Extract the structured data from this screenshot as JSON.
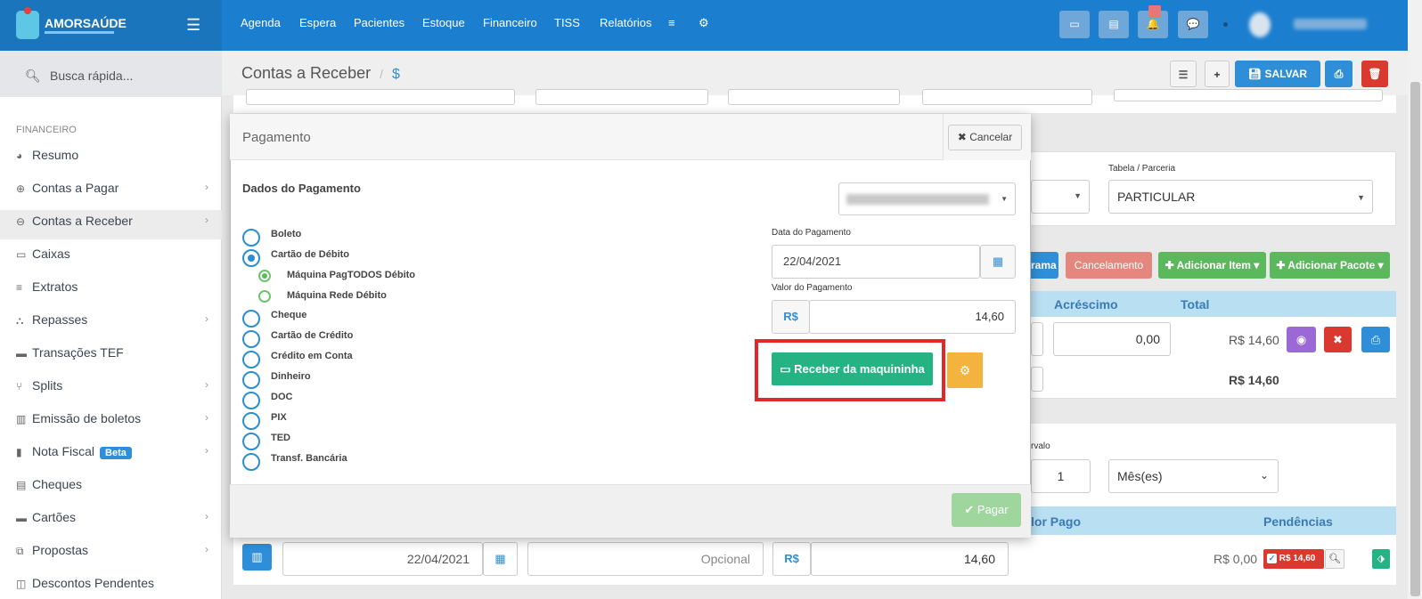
{
  "brand": {
    "name": "AMORSAÚDE"
  },
  "topnav": [
    "Agenda",
    "Espera",
    "Pacientes",
    "Estoque",
    "Financeiro",
    "TISS",
    "Relatórios"
  ],
  "sidebar": {
    "search_placeholder": "Busca rápida...",
    "section": "FINANCEIRO",
    "items": [
      {
        "label": "Resumo",
        "icon": "pie-icon"
      },
      {
        "label": "Contas a Pagar",
        "icon": "arrow-up-icon"
      },
      {
        "label": "Contas a Receber",
        "icon": "arrow-down-icon"
      },
      {
        "label": "Caixas",
        "icon": "inbox-icon"
      },
      {
        "label": "Extratos",
        "icon": "list-icon"
      },
      {
        "label": "Repasses",
        "icon": "sitemap-icon"
      },
      {
        "label": "Transações TEF",
        "icon": "card-icon"
      },
      {
        "label": "Splits",
        "icon": "split-icon"
      },
      {
        "label": "Emissão de boletos",
        "icon": "barcode-icon"
      },
      {
        "label": "Nota Fiscal",
        "icon": "file-icon",
        "badge": "Beta"
      },
      {
        "label": "Cheques",
        "icon": "cheque-icon"
      },
      {
        "label": "Cartões",
        "icon": "card-icon"
      },
      {
        "label": "Propostas",
        "icon": "copy-icon"
      },
      {
        "label": "Descontos Pendentes",
        "icon": "money-icon"
      }
    ]
  },
  "header": {
    "title": "Contas a Receber",
    "title_icon": "$",
    "save": "SALVAR"
  },
  "background": {
    "tabela_label": "Tabela / Parceria",
    "tabela_value": "PARTICULAR",
    "btn_programa": "rama",
    "btn_cancel": "Cancelamento",
    "btn_add_item": "Adicionar Item",
    "btn_add_pacote": "Adicionar Pacote",
    "col_acrescimo": "Acréscimo",
    "col_total": "Total",
    "row_acrescimo": "0,00",
    "row_total": "R$ 14,60",
    "sum_total": "R$ 14,60",
    "intervalo_label": "rvalo",
    "intervalo_value": "1",
    "intervalo_unit": "Mês(es)",
    "col_valor_pago": "lor Pago",
    "col_pendencias": "Pendências",
    "pay_date": "22/04/2021",
    "pay_opcional": "Opcional",
    "pay_currency": "R$",
    "pay_value": "14,60",
    "pago": "R$ 0,00",
    "pend_badge": "R$ 14,60"
  },
  "modal": {
    "title": "Pagamento",
    "cancel": "Cancelar",
    "section": "Dados do Pagamento",
    "methods": [
      "Boleto",
      "Cartão de Débito",
      "Cheque",
      "Cartão de Crédito",
      "Crédito em Conta",
      "Dinheiro",
      "DOC",
      "PIX",
      "TED",
      "Transf. Bancária"
    ],
    "sub_methods": [
      "Máquina PagTODOS Débito",
      "Máquina Rede Débito"
    ],
    "date_label": "Data do Pagamento",
    "date_value": "22/04/2021",
    "value_label": "Valor do Pagamento",
    "currency": "R$",
    "value": "14,60",
    "btn_receber": "Receber da maquininha",
    "btn_pagar": "Pagar"
  }
}
